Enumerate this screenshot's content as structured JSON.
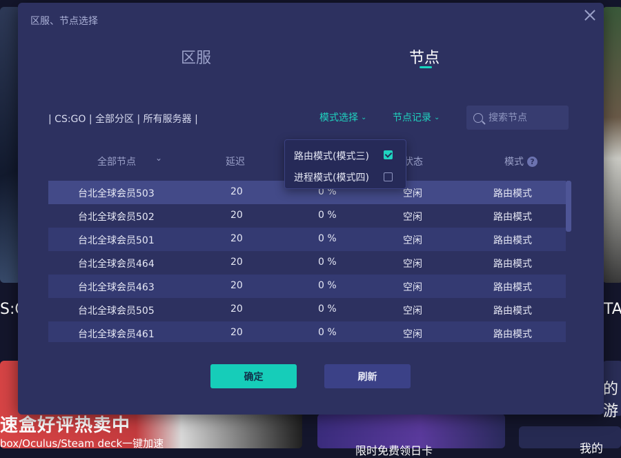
{
  "background": {
    "left_text": "S:G",
    "right_text": "TA",
    "strip_text": "的游",
    "promo1_title": "速盒好评热卖中",
    "promo1_sub": "box/Oculus/Steam deck一键加速",
    "promo2_text": "限时免费领日卡",
    "promo3_text": "我的"
  },
  "modal": {
    "title": "区服、节点选择",
    "tabs": [
      {
        "label": "区服",
        "active": false
      },
      {
        "label": "节点",
        "active": true
      }
    ],
    "breadcrumb": "| CS:GO | 全部分区 | 所有服务器 |",
    "mode_select_label": "模式选择",
    "node_record_label": "节点记录",
    "search": {
      "placeholder": "搜索节点",
      "value": ""
    },
    "columns": {
      "name": "全部节点",
      "latency": "延迟",
      "status": "状态",
      "mode": "模式"
    },
    "rows": [
      {
        "name": "台北全球会员503",
        "latency": "20",
        "loss": "0 %",
        "status": "空闲",
        "mode": "路由模式"
      },
      {
        "name": "台北全球会员502",
        "latency": "20",
        "loss": "0 %",
        "status": "空闲",
        "mode": "路由模式"
      },
      {
        "name": "台北全球会员501",
        "latency": "20",
        "loss": "0 %",
        "status": "空闲",
        "mode": "路由模式"
      },
      {
        "name": "台北全球会员464",
        "latency": "20",
        "loss": "0 %",
        "status": "空闲",
        "mode": "路由模式"
      },
      {
        "name": "台北全球会员463",
        "latency": "20",
        "loss": "0 %",
        "status": "空闲",
        "mode": "路由模式"
      },
      {
        "name": "台北全球会员505",
        "latency": "20",
        "loss": "0 %",
        "status": "空闲",
        "mode": "路由模式"
      },
      {
        "name": "台北全球会员461",
        "latency": "20",
        "loss": "0 %",
        "status": "空闲",
        "mode": "路由模式"
      }
    ],
    "mode_options": [
      {
        "label": "路由模式(模式三)",
        "checked": true
      },
      {
        "label": "进程模式(模式四)",
        "checked": false
      }
    ],
    "confirm_label": "确定",
    "refresh_label": "刷新"
  },
  "colors": {
    "accent": "#1fd3bf",
    "modal_bg": "#2d3160",
    "row_alt": "#343a72",
    "row_selected": "#434a88"
  }
}
